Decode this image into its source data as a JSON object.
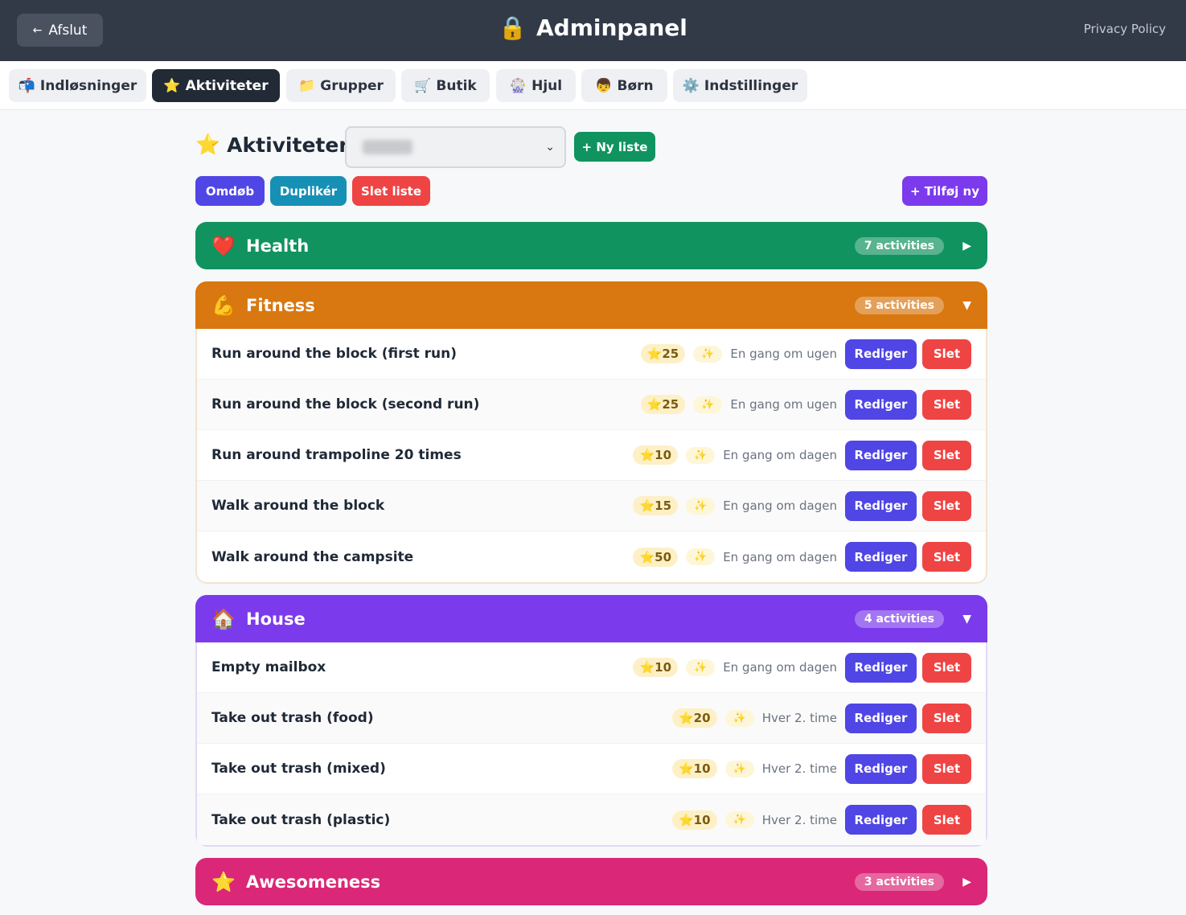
{
  "header": {
    "back_label": "Afslut",
    "back_icon": "←",
    "title_icon": "🔒",
    "title": "Adminpanel",
    "privacy_label": "Privacy Policy"
  },
  "tabs": [
    {
      "icon": "📬",
      "label": "Indløsninger",
      "active": false
    },
    {
      "icon": "⭐",
      "label": "Aktiviteter",
      "active": true
    },
    {
      "icon": "📁",
      "label": "Grupper",
      "active": false
    },
    {
      "icon": "🛒",
      "label": "Butik",
      "active": false
    },
    {
      "icon": "🎡",
      "label": "Hjul",
      "active": false
    },
    {
      "icon": "👦",
      "label": "Børn",
      "active": false
    },
    {
      "icon": "⚙️",
      "label": "Indstillinger",
      "active": false
    }
  ],
  "main": {
    "heading_icon": "⭐",
    "heading": "Aktiviteter",
    "new_list_label": "+ Ny liste",
    "rename_label": "Omdøb",
    "duplicate_label": "Duplikér",
    "delete_list_label": "Slet liste",
    "add_new_label": "+ Tilføj ny"
  },
  "colors": {
    "health": "#10935f",
    "fitness": "#d97710",
    "house": "#7c3aed",
    "awesomeness": "#db2777"
  },
  "categories": [
    {
      "emoji": "❤️",
      "name": "Health",
      "count": "7 activities",
      "toggle": "▶",
      "expanded": false
    },
    {
      "emoji": "💪",
      "name": "Fitness",
      "count": "5 activities",
      "toggle": "▼",
      "expanded": true,
      "activities": [
        {
          "name": "Run around the block (first run)",
          "points": "⭐25",
          "sparkle": "✨",
          "frequency": "En gang om ugen",
          "edit": "Rediger",
          "delete": "Slet"
        },
        {
          "name": "Run around the block (second run)",
          "points": "⭐25",
          "sparkle": "✨",
          "frequency": "En gang om ugen",
          "edit": "Rediger",
          "delete": "Slet"
        },
        {
          "name": "Run around trampoline 20 times",
          "points": "⭐10",
          "sparkle": "✨",
          "frequency": "En gang om dagen",
          "edit": "Rediger",
          "delete": "Slet"
        },
        {
          "name": "Walk around the block",
          "points": "⭐15",
          "sparkle": "✨",
          "frequency": "En gang om dagen",
          "edit": "Rediger",
          "delete": "Slet"
        },
        {
          "name": "Walk around the campsite",
          "points": "⭐50",
          "sparkle": "✨",
          "frequency": "En gang om dagen",
          "edit": "Rediger",
          "delete": "Slet"
        }
      ]
    },
    {
      "emoji": "🏠",
      "name": "House",
      "count": "4 activities",
      "toggle": "▼",
      "expanded": true,
      "activities": [
        {
          "name": "Empty mailbox",
          "points": "⭐10",
          "sparkle": "✨",
          "frequency": "En gang om dagen",
          "edit": "Rediger",
          "delete": "Slet"
        },
        {
          "name": "Take out trash (food)",
          "points": "⭐20",
          "sparkle": "✨",
          "frequency": "Hver 2. time",
          "edit": "Rediger",
          "delete": "Slet"
        },
        {
          "name": "Take out trash (mixed)",
          "points": "⭐10",
          "sparkle": "✨",
          "frequency": "Hver 2. time",
          "edit": "Rediger",
          "delete": "Slet"
        },
        {
          "name": "Take out trash (plastic)",
          "points": "⭐10",
          "sparkle": "✨",
          "frequency": "Hver 2. time",
          "edit": "Rediger",
          "delete": "Slet"
        }
      ]
    },
    {
      "emoji": "⭐",
      "name": "Awesomeness",
      "count": "3 activities",
      "toggle": "▶",
      "expanded": false
    }
  ]
}
